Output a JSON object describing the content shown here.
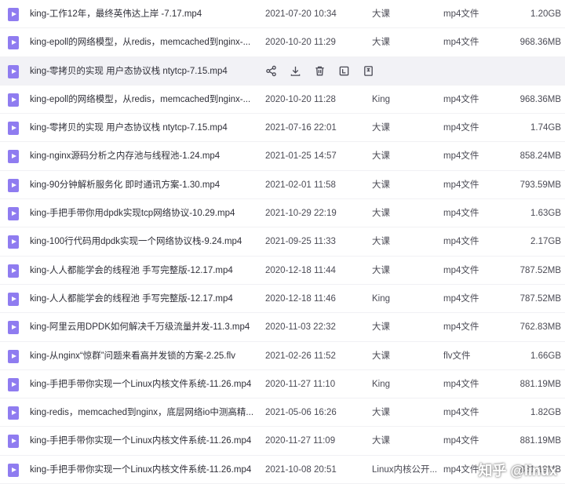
{
  "rows": [
    {
      "name": "king-工作12年，最终英伟达上岸 -7.17.mp4",
      "date": "2021-07-20 10:34",
      "owner": "大课",
      "type": "mp4文件",
      "size": "1.20GB"
    },
    {
      "name": "king-epoll的网络模型，从redis，memcached到nginx-...",
      "date": "2020-10-20 11:29",
      "owner": "大课",
      "type": "mp4文件",
      "size": "968.36MB"
    },
    {
      "name": "king-零拷贝的实现 用户态协议栈 ntytcp-7.15.mp4",
      "date": "",
      "owner": "",
      "type": "",
      "size": ""
    },
    {
      "name": "king-epoll的网络模型，从redis，memcached到nginx-...",
      "date": "2020-10-20 11:28",
      "owner": "King",
      "type": "mp4文件",
      "size": "968.36MB"
    },
    {
      "name": "king-零拷贝的实现 用户态协议栈 ntytcp-7.15.mp4",
      "date": "2021-07-16 22:01",
      "owner": "大课",
      "type": "mp4文件",
      "size": "1.74GB"
    },
    {
      "name": "king-nginx源码分析之内存池与线程池-1.24.mp4",
      "date": "2021-01-25 14:57",
      "owner": "大课",
      "type": "mp4文件",
      "size": "858.24MB"
    },
    {
      "name": "king-90分钟解析服务化 即时通讯方案-1.30.mp4",
      "date": "2021-02-01 11:58",
      "owner": "大课",
      "type": "mp4文件",
      "size": "793.59MB"
    },
    {
      "name": "king-手把手带你用dpdk实现tcp网络协议-10.29.mp4",
      "date": "2021-10-29 22:19",
      "owner": "大课",
      "type": "mp4文件",
      "size": "1.63GB"
    },
    {
      "name": "king-100行代码用dpdk实现一个网络协议栈-9.24.mp4",
      "date": "2021-09-25 11:33",
      "owner": "大课",
      "type": "mp4文件",
      "size": "2.17GB"
    },
    {
      "name": "king-人人都能学会的线程池 手写完整版-12.17.mp4",
      "date": "2020-12-18 11:44",
      "owner": "大课",
      "type": "mp4文件",
      "size": "787.52MB"
    },
    {
      "name": "king-人人都能学会的线程池 手写完整版-12.17.mp4",
      "date": "2020-12-18 11:46",
      "owner": "King",
      "type": "mp4文件",
      "size": "787.52MB"
    },
    {
      "name": "king-阿里云用DPDK如何解决千万级流量并发-11.3.mp4",
      "date": "2020-11-03 22:32",
      "owner": "大课",
      "type": "mp4文件",
      "size": "762.83MB"
    },
    {
      "name": "king-从nginx“惊群”问题来看高并发锁的方案-2.25.flv",
      "date": "2021-02-26 11:52",
      "owner": "大课",
      "type": "flv文件",
      "size": "1.66GB"
    },
    {
      "name": "king-手把手带你实现一个Linux内核文件系统-11.26.mp4",
      "date": "2020-11-27 11:10",
      "owner": "King",
      "type": "mp4文件",
      "size": "881.19MB"
    },
    {
      "name": "king-redis，memcached到nginx，底层网络io中测高精...",
      "date": "2021-05-06 16:26",
      "owner": "大课",
      "type": "mp4文件",
      "size": "1.82GB"
    },
    {
      "name": "king-手把手带你实现一个Linux内核文件系统-11.26.mp4",
      "date": "2020-11-27 11:09",
      "owner": "大课",
      "type": "mp4文件",
      "size": "881.19MB"
    },
    {
      "name": "king-手把手带你实现一个Linux内核文件系统-11.26.mp4",
      "date": "2021-10-08 20:51",
      "owner": "Linux内核公开...",
      "type": "mp4文件",
      "size": "881.19MB"
    }
  ],
  "hover_actions": [
    "share-icon",
    "download-icon",
    "delete-icon",
    "more-icon",
    "save-icon"
  ],
  "watermark": "知乎 @linux",
  "colors": {
    "file_icon": "#8f7cf0",
    "hover_bg": "#f2f2f6"
  }
}
